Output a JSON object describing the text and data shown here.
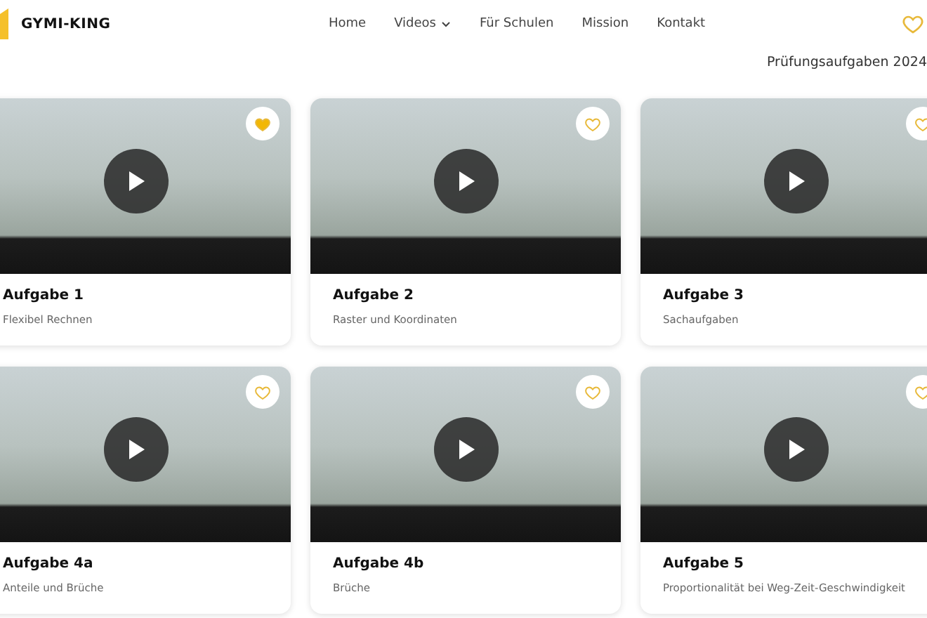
{
  "header": {
    "logo": "GYMI-KING",
    "nav": [
      {
        "label": "Home",
        "has_menu": false
      },
      {
        "label": "Videos",
        "has_menu": true
      },
      {
        "label": "Für Schulen",
        "has_menu": false
      },
      {
        "label": "Mission",
        "has_menu": false
      },
      {
        "label": "Kontakt",
        "has_menu": false
      }
    ]
  },
  "section_title": "Prüfungsaufgaben 2024",
  "videos": [
    {
      "title": "Aufgabe 1",
      "subtitle": "Flexibel Rechnen",
      "liked": true
    },
    {
      "title": "Aufgabe 2",
      "subtitle": "Raster und Koordinaten",
      "liked": false
    },
    {
      "title": "Aufgabe 3",
      "subtitle": "Sachaufgaben",
      "liked": false
    },
    {
      "title": "Aufgabe 4a",
      "subtitle": "Anteile und Brüche",
      "liked": false
    },
    {
      "title": "Aufgabe 4b",
      "subtitle": "Brüche",
      "liked": false
    },
    {
      "title": "Aufgabe 5",
      "subtitle": "Proportionalität bei Weg-Zeit-Geschwindigkeit",
      "liked": false
    }
  ]
}
